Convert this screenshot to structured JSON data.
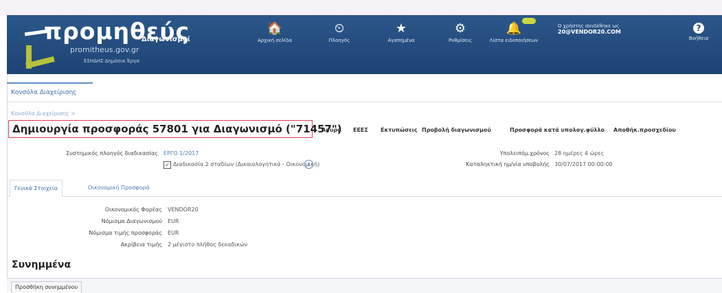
{
  "brand": {
    "name": "προμηθεύς",
    "sub": "Διαγωνισμοί",
    "url": "promitheus.gov.gr",
    "org": "ΕΣΗΔΗΣ Δημόσια Έργα"
  },
  "nav": [
    {
      "icon": "home-icon",
      "glyph": "🏠",
      "label": "Αρχική σελίδα"
    },
    {
      "icon": "clock-icon",
      "glyph": "⏲",
      "label": "Πλοηγός"
    },
    {
      "icon": "star-icon",
      "glyph": "★",
      "label": "Αγαπημένα"
    },
    {
      "icon": "gear-icon",
      "glyph": "⚙",
      "label": "Ρυθμίσεις"
    },
    {
      "icon": "bell-icon",
      "glyph": "🔔",
      "label": "Λίστα ειδοποιήσεων"
    }
  ],
  "user": {
    "line1": "Ο χρήστης συνδέθηκε ως",
    "line2": "20@VENDOR20.COM"
  },
  "help": {
    "label": "Βοήθεια",
    "glyph": "?"
  },
  "tabs": {
    "dashboard": "Κονσόλα Διαχείρισης"
  },
  "breadcrumb": "Κονσόλα Διαχείρισης  >",
  "page": {
    "title": "Δημιουργία προσφοράς 57801 για Διαγωνισμό (\"71457\")"
  },
  "toolbar": [
    "Άκυρο",
    "ΕΕΕΣ",
    "Εκτυπώσεις",
    "Προβολή διαγωνισμού",
    "Προσφορά κατά υπολογ.φύλλο",
    "Αποθήκ.προσχεδίου"
  ],
  "details": {
    "system_label": "Συστημικός πλοηγός διαδικασίας",
    "system_value": "ΕΡΓΟ 1/2017",
    "stage_text": "Διαδικασία 2 σταδίων (Δικαιολογητικά - Οικονομική)",
    "remaining_label": "Υπολειπόμ.χρόνος",
    "remaining_value": "28 ημέρες 4 ώρες",
    "deadline_label": "Καταληκτική ημ/νία υποβολής",
    "deadline_value": "30/07/2017 00:00:00"
  },
  "subtabs": [
    "Γενικά Στοιχεία",
    "Οικονομική Προσφορά"
  ],
  "general": [
    {
      "label": "Οικονομικός Φορέας",
      "value": "VENDOR20"
    },
    {
      "label": "Νόμισμα Διαγωνισμού",
      "value": "EUR"
    },
    {
      "label": "Νόμισμα τιμής προσφοράς",
      "value": "EUR"
    },
    {
      "label": "Ακρίβεια τιμής",
      "value": "2 μέγιστο πλήθος δεκαδικών"
    }
  ],
  "attachments": {
    "title": "Συνημμένα",
    "button": "Προσθήκη συνημμένου"
  }
}
